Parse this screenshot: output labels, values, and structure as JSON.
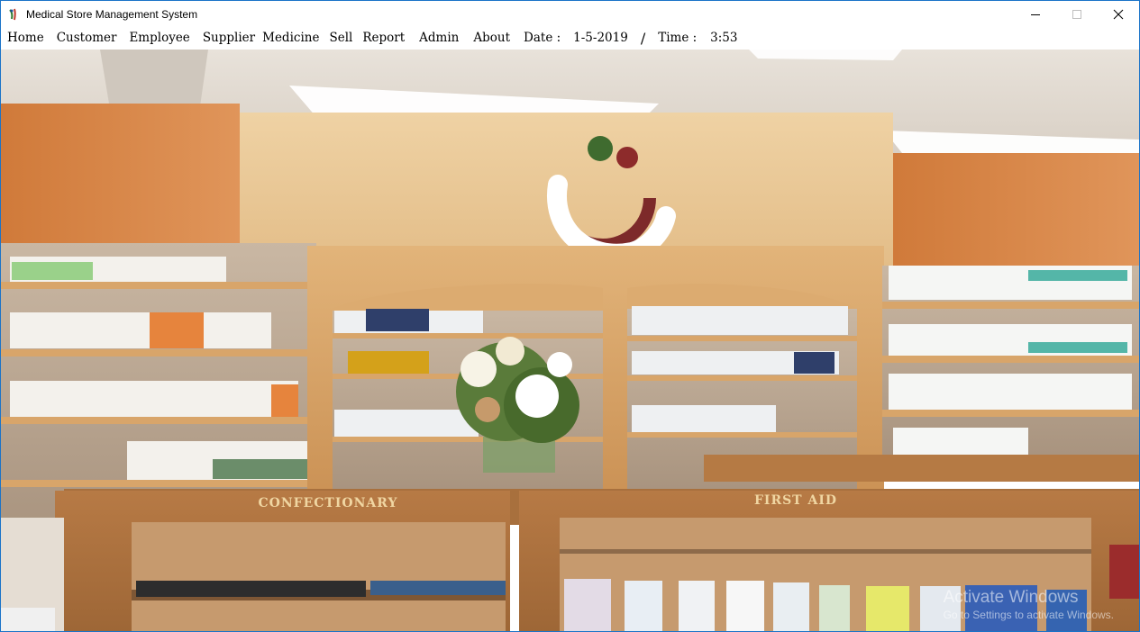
{
  "window": {
    "title": "Medical Store Management System",
    "controls": [
      "minimize-icon",
      "maximize-icon",
      "close-icon"
    ]
  },
  "menu": {
    "items": [
      "Home",
      "Customer",
      "Employee",
      "Supplier",
      "Medicine",
      "Sell",
      "Report",
      "Admin",
      "About"
    ],
    "date_label": "Date :",
    "date_value": "1-5-2019",
    "separator": "/",
    "time_label": "Time :",
    "time_value": "3:53"
  },
  "background": {
    "description_icon": "pharmacy-store-photo",
    "signs": [
      "CONFECTIONARY",
      "FIRST AID"
    ]
  },
  "watermark": {
    "title": "Activate Windows",
    "subtitle": "Go to Settings to activate Windows."
  },
  "colors": {
    "window_border": "#1a73c8",
    "wall_orange": "#d98a4a",
    "wall_beige": "#e9c89a",
    "wood": "#d9a66a"
  }
}
